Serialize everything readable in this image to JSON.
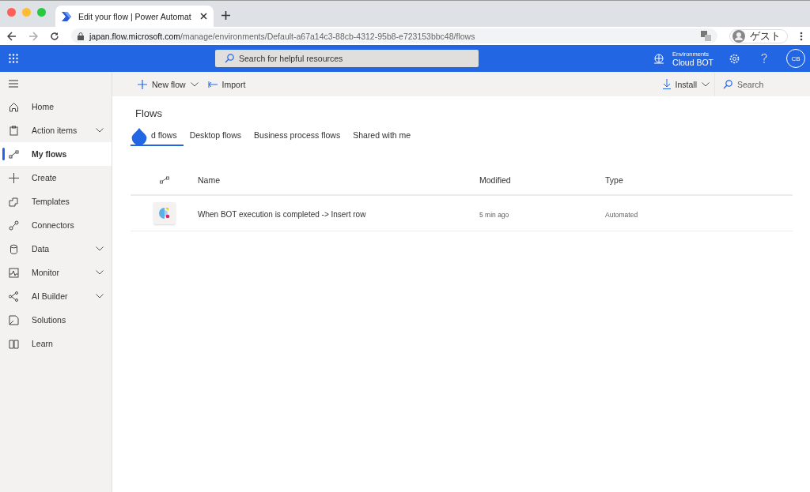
{
  "browser": {
    "tab_title": "Edit your flow | Power Automat",
    "url_host": "japan.flow.microsoft.com",
    "url_path": "/manage/environments/Default-a67a14c3-88cb-4312-95b8-e723153bbc48/flows",
    "profile": "ゲスト"
  },
  "header": {
    "search_placeholder": "Search for helpful resources",
    "environment_label": "Environments",
    "environment": "Cloud BOT",
    "avatar": "CB"
  },
  "command_bar": {
    "new_flow": "New flow",
    "import": "Import",
    "install": "Install",
    "search_placeholder": "Search"
  },
  "sidebar": {
    "items": [
      {
        "label": "Home",
        "expandable": false,
        "selected": false
      },
      {
        "label": "Action items",
        "expandable": true,
        "selected": false
      },
      {
        "label": "My flows",
        "expandable": false,
        "selected": true
      },
      {
        "label": "Create",
        "expandable": false,
        "selected": false
      },
      {
        "label": "Templates",
        "expandable": false,
        "selected": false
      },
      {
        "label": "Connectors",
        "expandable": false,
        "selected": false
      },
      {
        "label": "Data",
        "expandable": true,
        "selected": false
      },
      {
        "label": "Monitor",
        "expandable": true,
        "selected": false
      },
      {
        "label": "AI Builder",
        "expandable": true,
        "selected": false
      },
      {
        "label": "Solutions",
        "expandable": false,
        "selected": false
      },
      {
        "label": "Learn",
        "expandable": false,
        "selected": false
      }
    ]
  },
  "page_title": "Flows",
  "tabs": [
    {
      "label": "d flows",
      "selected": true
    },
    {
      "label": "Desktop flows",
      "selected": false
    },
    {
      "label": "Business process flows",
      "selected": false
    },
    {
      "label": "Shared with me",
      "selected": false
    }
  ],
  "table": {
    "columns": [
      "Name",
      "Modified",
      "Type"
    ],
    "rows": [
      {
        "name": "When BOT execution is completed -> Insert row",
        "modified": "5 min ago",
        "type": "Automated"
      }
    ]
  }
}
